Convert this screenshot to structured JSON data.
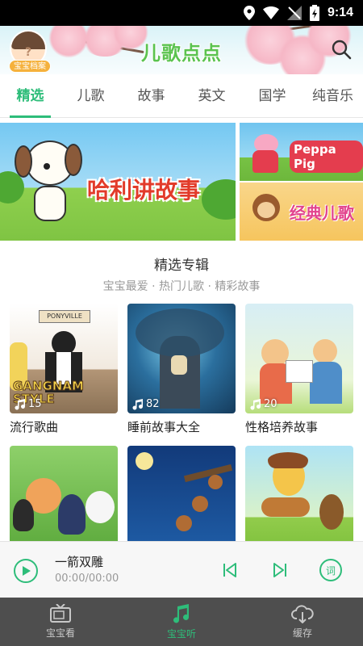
{
  "status_bar": {
    "time": "9:14"
  },
  "header": {
    "app_logo": "儿歌点点",
    "avatar_badge": "宝宝档案",
    "avatar_placeholder": "?"
  },
  "tabs": [
    {
      "label": "精选",
      "active": true
    },
    {
      "label": "儿歌",
      "active": false
    },
    {
      "label": "故事",
      "active": false
    },
    {
      "label": "英文",
      "active": false
    },
    {
      "label": "国学",
      "active": false
    },
    {
      "label": "纯音乐",
      "active": false
    }
  ],
  "banners": {
    "main_title": "哈利讲故事",
    "peppa_title": "Peppa Pig",
    "erge_title": "经典儿歌"
  },
  "section": {
    "title": "精选专辑",
    "subtitle": "宝宝最爱 · 热门儿歌 · 精彩故事"
  },
  "albums": [
    {
      "title": "流行歌曲",
      "count": "15",
      "sign_text": "PONYVILLE",
      "art_text": "GANGNAM STYLE"
    },
    {
      "title": "睡前故事大全",
      "count": "82"
    },
    {
      "title": "性格培养故事",
      "count": "20"
    },
    {
      "title": "",
      "count": ""
    },
    {
      "title": "",
      "count": ""
    },
    {
      "title": "",
      "count": ""
    }
  ],
  "player": {
    "song_title": "一箭双雕",
    "time": "00:00/00:00",
    "lyrics_label": "词"
  },
  "bottom_nav": [
    {
      "label": "宝宝看",
      "active": false
    },
    {
      "label": "宝宝听",
      "active": true
    },
    {
      "label": "缓存",
      "active": false
    }
  ],
  "colors": {
    "accent": "#2ebd7a",
    "nav_bg": "#4e4e4e",
    "status_bg": "#000000"
  }
}
